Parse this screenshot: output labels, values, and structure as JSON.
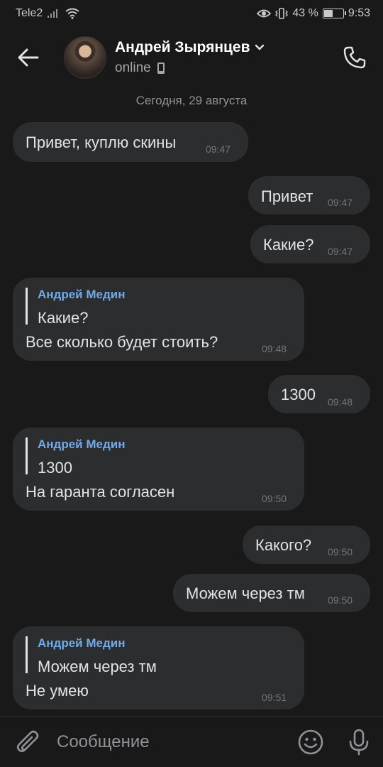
{
  "status_bar": {
    "carrier": "Tele2",
    "battery": "43 %",
    "battery_level": 0.43,
    "time": "9:53"
  },
  "header": {
    "name": "Андрей Зырянцев",
    "status": "online"
  },
  "date_separator": "Сегодня, 29 августа",
  "messages": [
    {
      "text": "Привет, куплю скины",
      "time": "09:47"
    },
    {
      "text": "Привет",
      "time": "09:47"
    },
    {
      "text": "Какие?",
      "time": "09:47"
    },
    {
      "reply_author": "Андрей Медин",
      "reply_text": "Какие?",
      "text": "Все сколько будет стоить?",
      "time": "09:48"
    },
    {
      "text": "1300",
      "time": "09:48"
    },
    {
      "reply_author": "Андрей Медин",
      "reply_text": "1300",
      "text": "На гаранта согласен",
      "time": "09:50"
    },
    {
      "text": "Какого?",
      "time": "09:50"
    },
    {
      "text": "Можем через тм",
      "time": "09:50"
    },
    {
      "reply_author": "Андрей Медин",
      "reply_text": "Можем через тм",
      "text": "Не умею",
      "time": "09:51"
    }
  ],
  "composer": {
    "placeholder": "Сообщение"
  },
  "colors": {
    "background": "#19191a",
    "bubble": "#2c2d2e",
    "reply_author": "#71aaeb"
  }
}
